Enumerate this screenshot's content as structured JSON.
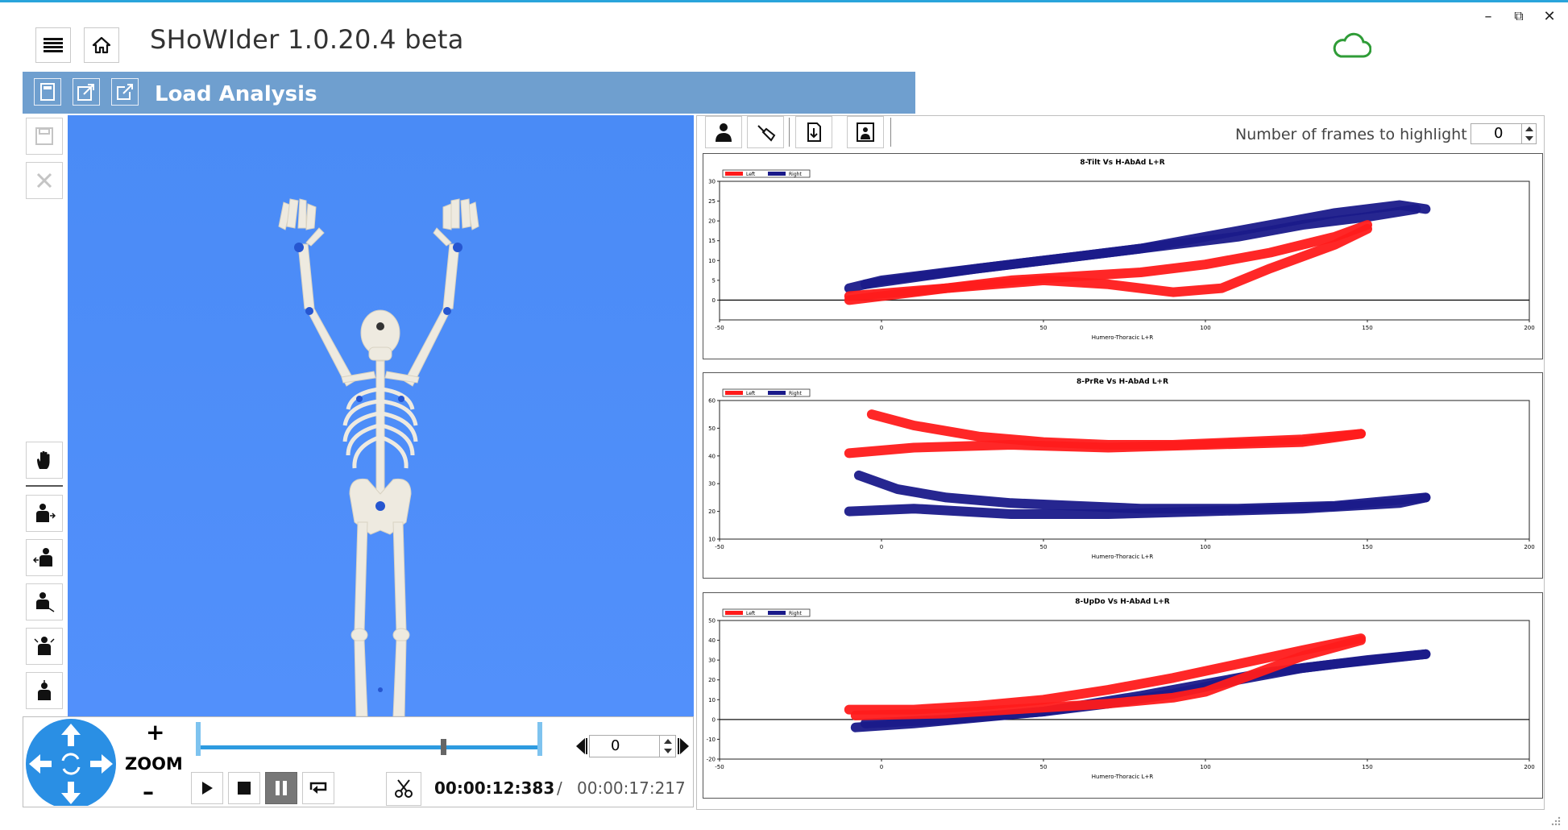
{
  "app": {
    "title": "SHoWIder 1.0.20.4 beta",
    "section_title": "Load Analysis"
  },
  "window_controls": {
    "minimize": "–",
    "restore": "⧉",
    "close": "✕"
  },
  "colors": {
    "accent": "#2aa4db",
    "header": "#6f9fcf",
    "viewport_bg": "#4d8cf5",
    "cloud": "#2f9c37",
    "left_series": "#ff1b1b",
    "right_series": "#1a1a8a"
  },
  "toolbar_icons": [
    "menu-icon",
    "home-icon"
  ],
  "header_icons": [
    "calculator-icon",
    "export-icon",
    "open-external-icon"
  ],
  "side_icons": [
    "save-icon",
    "close-icon",
    "hand-icon",
    "view-left-icon",
    "view-right-icon",
    "view-front-icon",
    "view-back-icon",
    "view-top-icon"
  ],
  "playback": {
    "zoom_label": "ZOOM",
    "zoom_plus": "+",
    "zoom_minus": "–",
    "frame_value": "0",
    "current_time": "00:00:12:383",
    "separator": "/",
    "total_time": "00:00:17:217",
    "slider_position": 0.72
  },
  "right_toolbar": {
    "highlight_label": "Number of frames to highlight",
    "highlight_value": "0"
  },
  "charts": [
    {
      "title": "8-Tilt Vs H-AbAd L+R",
      "xlabel": "Humero-Thoracic L+R",
      "legend": [
        "Left",
        "Right"
      ]
    },
    {
      "title": "8-PrRe Vs H-AbAd L+R",
      "xlabel": "Humero-Thoracic L+R",
      "legend": [
        "Left",
        "Right"
      ]
    },
    {
      "title": "8-UpDo Vs H-AbAd L+R",
      "xlabel": "Humero-Thoracic L+R",
      "legend": [
        "Left",
        "Right"
      ]
    }
  ],
  "chart_data": [
    {
      "type": "line",
      "title": "8-Tilt Vs H-AbAd L+R",
      "xlabel": "Humero-Thoracic L+R",
      "ylabel": "",
      "xlim": [
        -50,
        200
      ],
      "ylim": [
        -5,
        30
      ],
      "xticks": [
        "-50",
        "0",
        "50",
        "100",
        "150",
        "200"
      ],
      "yticks": [
        "0",
        "5",
        "10",
        "15",
        "20",
        "25",
        "30"
      ],
      "legend_position": "top-left",
      "series": [
        {
          "name": "Left",
          "color": "#ff1b1b",
          "x": [
            -10,
            0,
            20,
            40,
            60,
            80,
            100,
            120,
            140,
            150
          ],
          "y": [
            0,
            1,
            3,
            5,
            6,
            7,
            9,
            12,
            16,
            19
          ]
        },
        {
          "name": "Left",
          "color": "#ff1b1b",
          "x": [
            -10,
            20,
            50,
            70,
            90,
            105,
            120,
            140,
            150
          ],
          "y": [
            1,
            3,
            5,
            4,
            2,
            3,
            8,
            14,
            18
          ]
        },
        {
          "name": "Right",
          "color": "#1a1a8a",
          "x": [
            -10,
            0,
            20,
            40,
            60,
            80,
            100,
            120,
            140,
            160,
            168
          ],
          "y": [
            3,
            5,
            7,
            9,
            11,
            13,
            16,
            19,
            22,
            24,
            23
          ]
        },
        {
          "name": "Right",
          "color": "#1a1a8a",
          "x": [
            -5,
            30,
            60,
            90,
            110,
            130,
            150,
            165
          ],
          "y": [
            4,
            8,
            11,
            14,
            16,
            19,
            21,
            23
          ]
        }
      ]
    },
    {
      "type": "line",
      "title": "8-PrRe Vs H-AbAd L+R",
      "xlabel": "Humero-Thoracic L+R",
      "ylabel": "",
      "xlim": [
        -50,
        200
      ],
      "ylim": [
        10,
        60
      ],
      "xticks": [
        "-50",
        "0",
        "50",
        "100",
        "150",
        "200"
      ],
      "yticks": [
        "10",
        "20",
        "30",
        "40",
        "50",
        "60"
      ],
      "legend_position": "top-left",
      "series": [
        {
          "name": "Left",
          "color": "#ff1b1b",
          "x": [
            -3,
            10,
            30,
            50,
            70,
            90,
            110,
            130,
            148
          ],
          "y": [
            55,
            51,
            47,
            45,
            44,
            44,
            45,
            46,
            48
          ]
        },
        {
          "name": "Left",
          "color": "#ff1b1b",
          "x": [
            -10,
            10,
            40,
            70,
            100,
            130,
            148
          ],
          "y": [
            41,
            43,
            44,
            43,
            44,
            45,
            48
          ]
        },
        {
          "name": "Right",
          "color": "#1a1a8a",
          "x": [
            -7,
            5,
            20,
            40,
            60,
            80,
            110,
            140,
            168
          ],
          "y": [
            33,
            28,
            25,
            23,
            22,
            21,
            21,
            22,
            25
          ]
        },
        {
          "name": "Right",
          "color": "#1a1a8a",
          "x": [
            -10,
            10,
            40,
            70,
            100,
            130,
            160,
            168
          ],
          "y": [
            20,
            21,
            19,
            19,
            20,
            21,
            23,
            25
          ]
        }
      ]
    },
    {
      "type": "line",
      "title": "8-UpDo Vs H-AbAd L+R",
      "xlabel": "Humero-Thoracic L+R",
      "ylabel": "",
      "xlim": [
        -50,
        200
      ],
      "ylim": [
        -20,
        50
      ],
      "xticks": [
        "-50",
        "0",
        "50",
        "100",
        "150",
        "200"
      ],
      "yticks": [
        "-20",
        "-10",
        "0",
        "10",
        "20",
        "30",
        "40",
        "50"
      ],
      "legend_position": "top-left",
      "series": [
        {
          "name": "Left",
          "color": "#ff1b1b",
          "x": [
            -10,
            10,
            30,
            50,
            70,
            90,
            110,
            130,
            148
          ],
          "y": [
            5,
            5,
            7,
            10,
            15,
            21,
            28,
            35,
            41
          ]
        },
        {
          "name": "Left",
          "color": "#ff1b1b",
          "x": [
            -8,
            20,
            50,
            70,
            90,
            100,
            110,
            130,
            148
          ],
          "y": [
            2,
            3,
            6,
            8,
            11,
            14,
            20,
            32,
            40
          ]
        },
        {
          "name": "Right",
          "color": "#1a1a8a",
          "x": [
            -8,
            10,
            30,
            50,
            70,
            90,
            110,
            130,
            150,
            168
          ],
          "y": [
            -4,
            -2,
            1,
            4,
            8,
            13,
            20,
            26,
            30,
            33
          ]
        },
        {
          "name": "Right",
          "color": "#1a1a8a",
          "x": [
            -5,
            20,
            50,
            80,
            100,
            120,
            140,
            168
          ],
          "y": [
            -2,
            0,
            4,
            12,
            18,
            24,
            28,
            33
          ]
        }
      ]
    }
  ]
}
